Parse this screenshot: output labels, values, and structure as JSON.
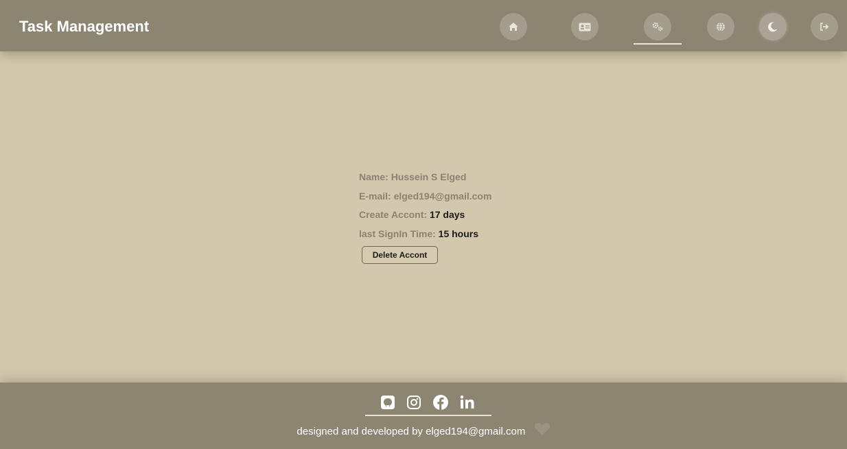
{
  "header": {
    "title": "Task Management",
    "nav": [
      {
        "name": "home-icon"
      },
      {
        "name": "id-card-icon"
      },
      {
        "name": "gears-icon",
        "active": true
      },
      {
        "name": "globe-icon"
      },
      {
        "name": "moon-icon"
      },
      {
        "name": "sign-out-icon"
      }
    ]
  },
  "profile": {
    "name_label": "Name: ",
    "name_value": "Hussein S Elged",
    "email_label": "E-mail: ",
    "email_value": "elged194@gmail.com",
    "created_label": "Create Accont: ",
    "created_value": "17 days",
    "signin_label": "last SignIn Time: ",
    "signin_value": "15 hours",
    "delete_button": "Delete Accont"
  },
  "footer": {
    "social": [
      "github-icon",
      "instagram-icon",
      "facebook-icon",
      "linkedin-icon"
    ],
    "credit": "designed and developed by elged194@gmail.com",
    "heart_icon": "heart-icon"
  },
  "colors": {
    "header_bg": "#8c8572",
    "page_bg": "#d3c8ad",
    "label": "#8a8272",
    "value": "#1c1a16"
  }
}
